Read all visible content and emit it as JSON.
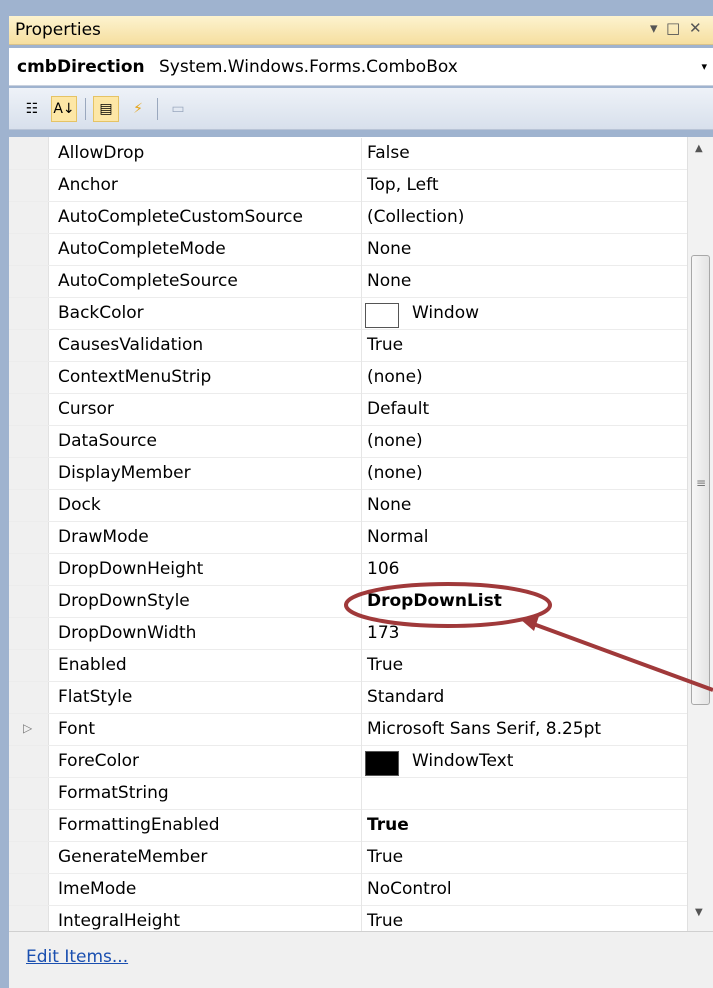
{
  "panel": {
    "title": "Properties",
    "pin_glyph": "▾",
    "maximize_glyph": "□",
    "close_glyph": "✕"
  },
  "object_selector": {
    "name": "cmbDirection",
    "type": "System.Windows.Forms.ComboBox",
    "dropdown_glyph": "▾"
  },
  "toolbar": {
    "categorized_glyph": "☷",
    "alphabetical_glyph": "A↓",
    "properties_glyph": "▤",
    "events_glyph": "⚡",
    "property_pages_glyph": "▭"
  },
  "properties": [
    {
      "name": "AllowDrop",
      "value": "False"
    },
    {
      "name": "Anchor",
      "value": "Top, Left"
    },
    {
      "name": "AutoCompleteCustomSource",
      "value": "(Collection)"
    },
    {
      "name": "AutoCompleteMode",
      "value": "None"
    },
    {
      "name": "AutoCompleteSource",
      "value": "None"
    },
    {
      "name": "BackColor",
      "value": "Window",
      "swatch": "#ffffff"
    },
    {
      "name": "CausesValidation",
      "value": "True"
    },
    {
      "name": "ContextMenuStrip",
      "value": "(none)"
    },
    {
      "name": "Cursor",
      "value": "Default"
    },
    {
      "name": "DataSource",
      "value": "(none)"
    },
    {
      "name": "DisplayMember",
      "value": "(none)"
    },
    {
      "name": "Dock",
      "value": "None"
    },
    {
      "name": "DrawMode",
      "value": "Normal"
    },
    {
      "name": "DropDownHeight",
      "value": "106"
    },
    {
      "name": "DropDownStyle",
      "value": "DropDownList",
      "bold": true
    },
    {
      "name": "DropDownWidth",
      "value": "173"
    },
    {
      "name": "Enabled",
      "value": "True"
    },
    {
      "name": "FlatStyle",
      "value": "Standard"
    },
    {
      "name": "Font",
      "value": "Microsoft Sans Serif, 8.25pt",
      "expandable": true
    },
    {
      "name": "ForeColor",
      "value": "WindowText",
      "swatch": "#000000"
    },
    {
      "name": "FormatString",
      "value": ""
    },
    {
      "name": "FormattingEnabled",
      "value": "True",
      "bold": true
    },
    {
      "name": "GenerateMember",
      "value": "True"
    },
    {
      "name": "ImeMode",
      "value": "NoControl"
    },
    {
      "name": "IntegralHeight",
      "value": "True"
    }
  ],
  "scrollbar": {
    "up_glyph": "▲",
    "down_glyph": "▼",
    "grip_glyph": "≡"
  },
  "commands": {
    "edit_items_label": "Edit Items..."
  },
  "colors": {
    "annotation": "#a0393a"
  }
}
